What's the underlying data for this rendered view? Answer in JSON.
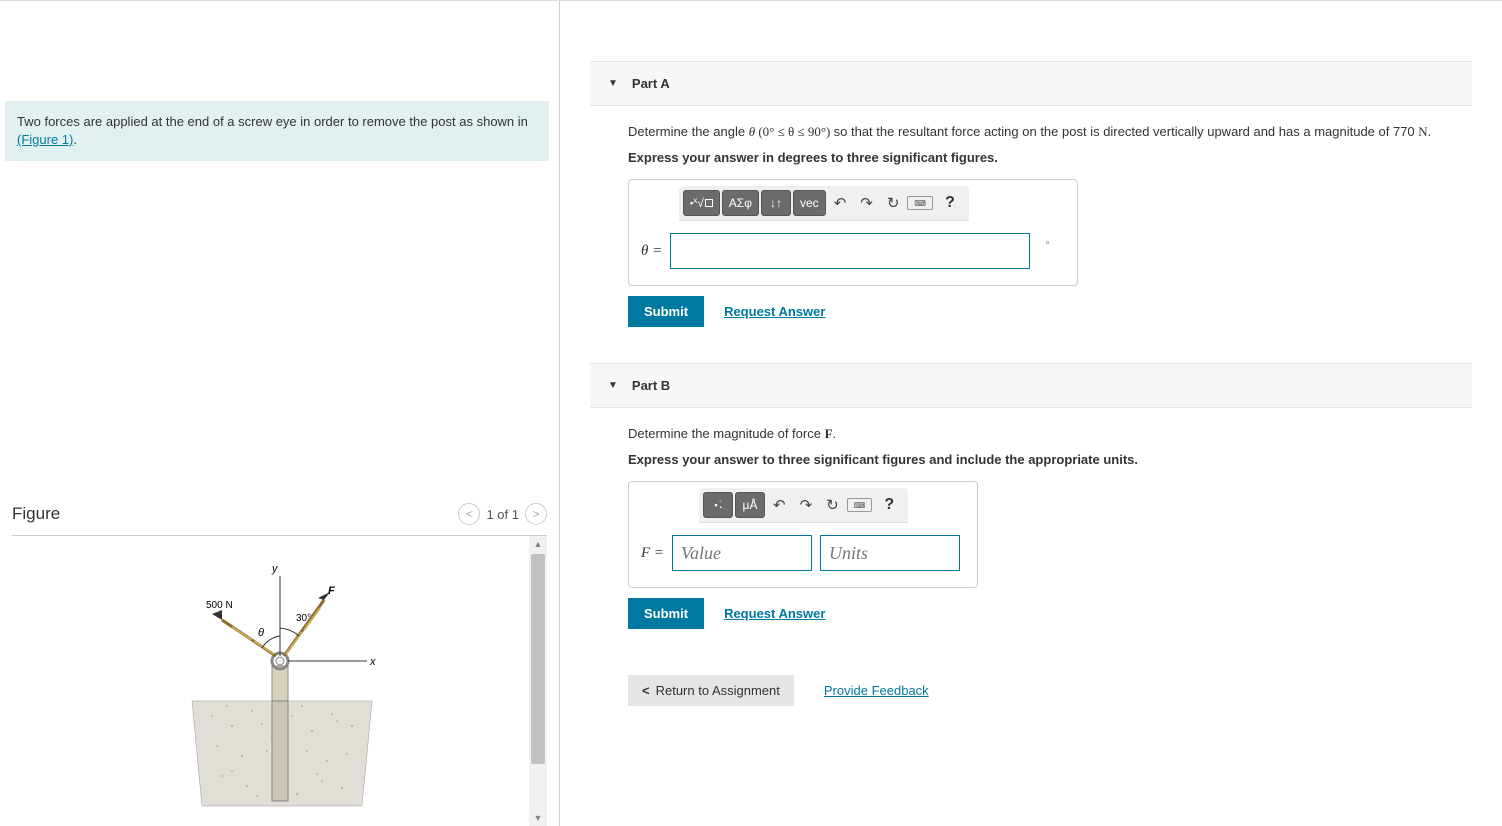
{
  "problem": {
    "text_before_link": "Two forces are applied at the end of a screw eye in order to remove the post as shown in ",
    "link_text": "(Figure 1)",
    "text_after_link": "."
  },
  "figure": {
    "title": "Figure",
    "pager": "1 of 1",
    "labels": {
      "force_left": "500 N",
      "force_right": "F",
      "angle_right": "30°",
      "angle_left": "θ",
      "y_axis": "y",
      "x_axis": "x"
    }
  },
  "partA": {
    "title": "Part A",
    "prompt_prefix": "Determine the angle ",
    "prompt_var": "θ",
    "prompt_range": " (0° ≤ θ ≤ 90°) ",
    "prompt_suffix": "so that the resultant force acting on the post is directed vertically upward and has a magnitude of 770 ",
    "prompt_unitbold": "N",
    "prompt_end": ".",
    "instruction": "Express your answer in degrees to three significant figures.",
    "var_label": "θ =",
    "unit_suffix": "∘",
    "toolbar": {
      "templates": "√",
      "greek": "ΑΣφ",
      "subsup": "↓↑",
      "vec": "vec",
      "undo": "↶",
      "redo": "↷",
      "reset": "↻",
      "keyboard": "⌨",
      "help": "?"
    },
    "submit": "Submit",
    "request": "Request Answer"
  },
  "partB": {
    "title": "Part B",
    "prompt_prefix": "Determine the magnitude of force ",
    "prompt_var": "F",
    "prompt_end": ".",
    "instruction": "Express your answer to three significant figures and include the appropriate units.",
    "var_label": "F =",
    "value_placeholder": "Value",
    "units_placeholder": "Units",
    "toolbar": {
      "templates": "□",
      "units": "μÅ",
      "undo": "↶",
      "redo": "↷",
      "reset": "↻",
      "keyboard": "⌨",
      "help": "?"
    },
    "submit": "Submit",
    "request": "Request Answer"
  },
  "footer": {
    "return": "Return to Assignment",
    "feedback": "Provide Feedback"
  }
}
